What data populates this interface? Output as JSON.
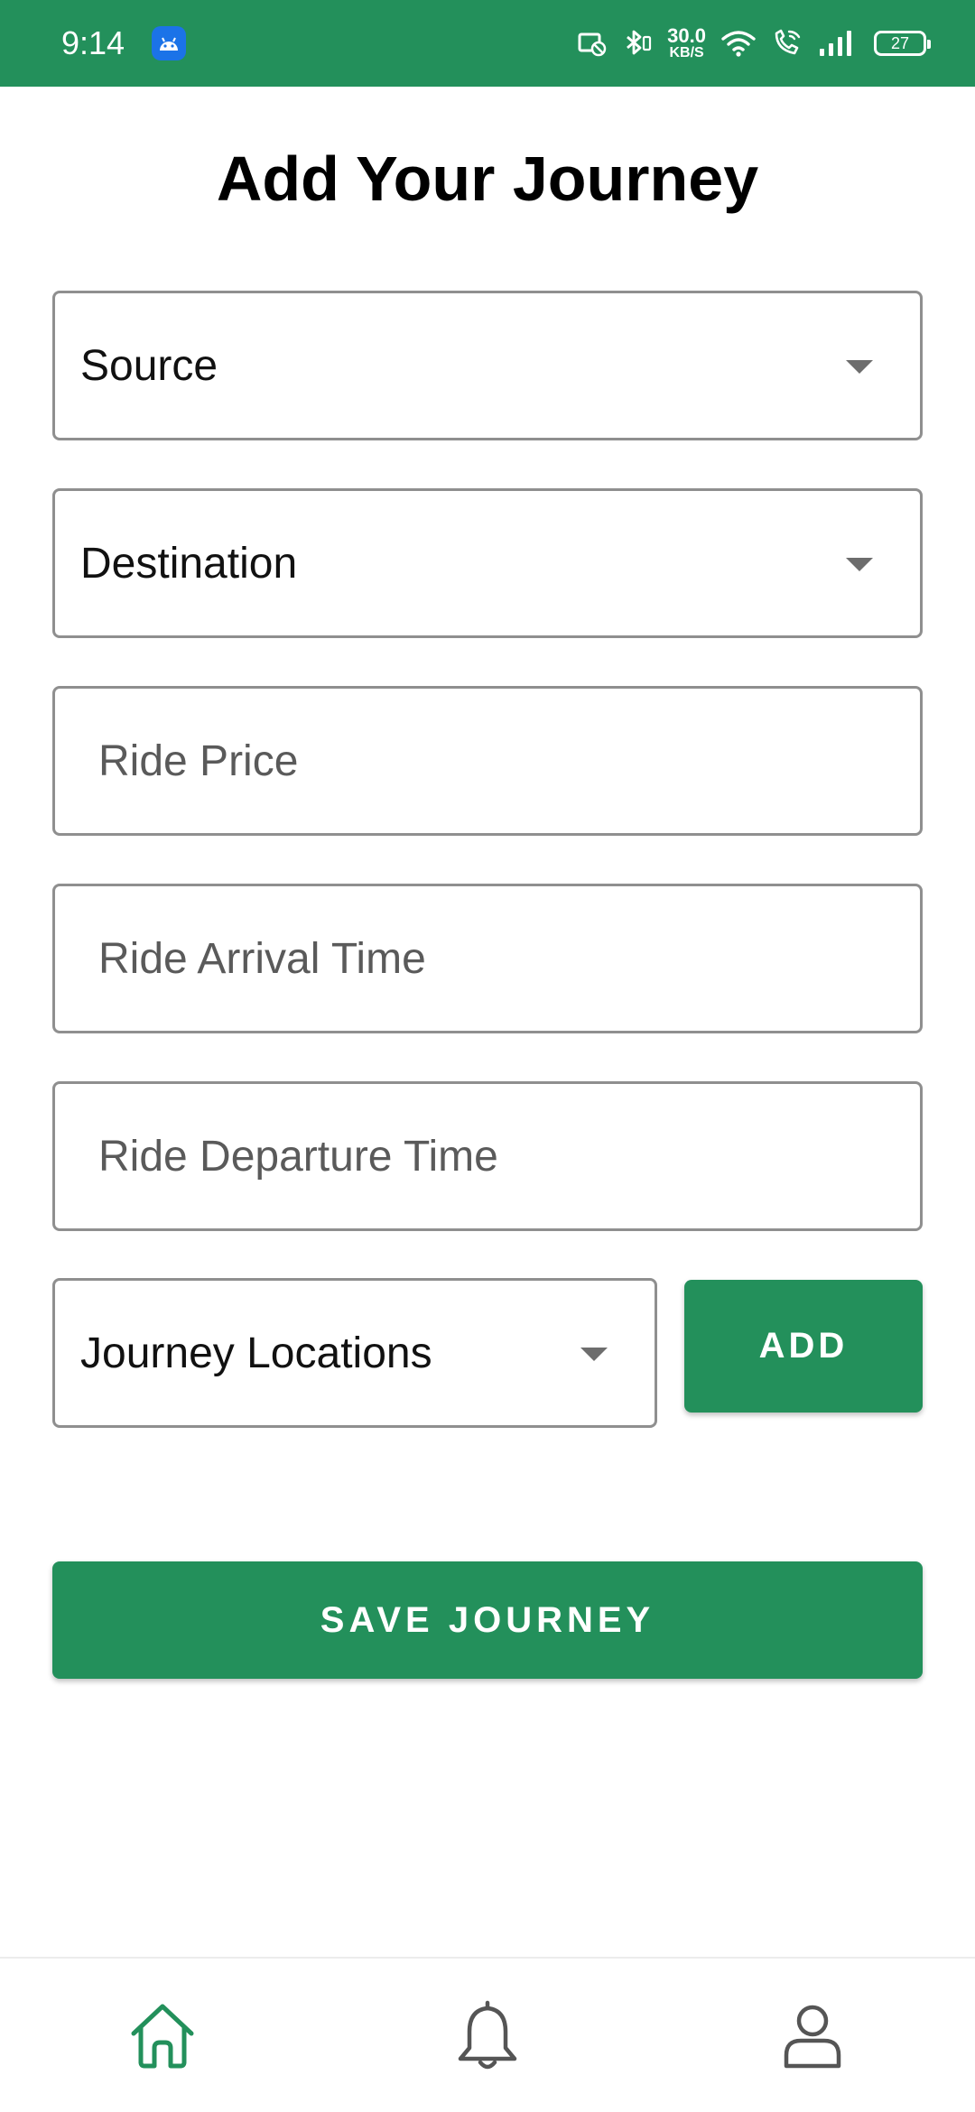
{
  "status_bar": {
    "time": "9:14",
    "net_speed_value": "30.0",
    "net_speed_unit": "KB/S",
    "battery": "27",
    "icons": [
      "android-icon",
      "cast-off-icon",
      "bluetooth-icon",
      "wifi-icon",
      "wifi-calling-icon",
      "signal-icon",
      "battery-icon"
    ],
    "color": "#23905b"
  },
  "page": {
    "title": "Add Your Journey"
  },
  "form": {
    "source_label": "Source",
    "destination_label": "Destination",
    "ride_price_placeholder": "Ride Price",
    "ride_arrival_placeholder": "Ride Arrival Time",
    "ride_departure_placeholder": "Ride Departure Time",
    "journey_locations_label": "Journey Locations",
    "add_label": "ADD",
    "save_label": "SAVE JOURNEY"
  },
  "bottom_nav": {
    "items": [
      {
        "icon": "home-icon",
        "active": true
      },
      {
        "icon": "bell-icon",
        "active": false
      },
      {
        "icon": "profile-icon",
        "active": false
      }
    ],
    "active_color": "#23905b",
    "inactive_color": "#555555"
  }
}
